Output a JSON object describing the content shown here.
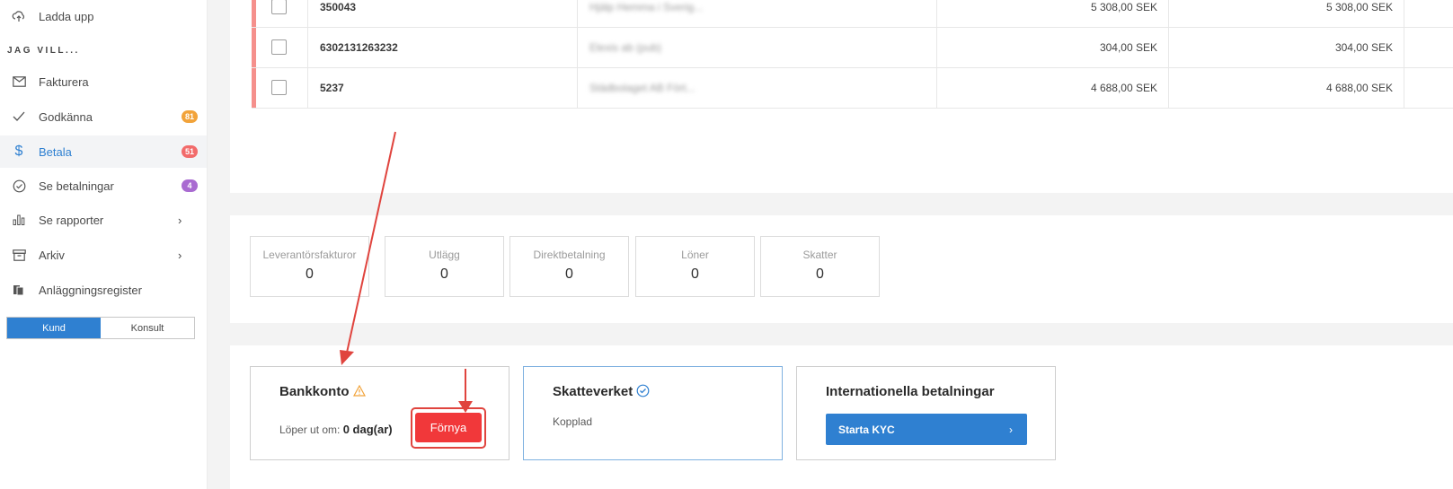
{
  "sidebar": {
    "upload_label": "Ladda upp",
    "section_title": "JAG VILL...",
    "items": [
      {
        "label": "Fakturera",
        "icon": "mail-icon"
      },
      {
        "label": "Godkänna",
        "icon": "check-icon",
        "badge": "81",
        "badge_color": "#f2a33a"
      },
      {
        "label": "Betala",
        "icon": "dollar-icon",
        "badge": "51",
        "badge_color": "#f26b6b"
      },
      {
        "label": "Se betalningar",
        "icon": "check-circle-icon",
        "badge": "4",
        "badge_color": "#a96bd1"
      },
      {
        "label": "Se rapporter",
        "icon": "bar-chart-icon"
      },
      {
        "label": "Arkiv",
        "icon": "archive-icon"
      },
      {
        "label": "Anläggningsregister",
        "icon": "files-icon"
      }
    ],
    "toggle": {
      "kund": "Kund",
      "konsult": "Konsult"
    }
  },
  "table": {
    "rows": [
      {
        "id": "350043",
        "name": "Hjälp Hemma i Sverig...",
        "amount1": "5 308,00 SEK",
        "amount2": "5 308,00 SEK"
      },
      {
        "id": "6302131263232",
        "name": "Elexis ab (pub)",
        "amount1": "304,00 SEK",
        "amount2": "304,00 SEK"
      },
      {
        "id": "5237",
        "name": "Städbolaget AB Fört...",
        "amount1": "4 688,00 SEK",
        "amount2": "4 688,00 SEK"
      }
    ]
  },
  "summary": [
    {
      "label": "Leverantörsfakturor",
      "value": "0"
    },
    {
      "label": "Utlägg",
      "value": "0"
    },
    {
      "label": "Direktbetalning",
      "value": "0"
    },
    {
      "label": "Löner",
      "value": "0"
    },
    {
      "label": "Skatter",
      "value": "0"
    }
  ],
  "cards": {
    "bank": {
      "title": "Bankkonto",
      "expires_prefix": "Löper ut om:",
      "expires_value": "0 dag(ar)",
      "renew_label": "Förnya"
    },
    "tax": {
      "title": "Skatteverket",
      "status": "Kopplad"
    },
    "intl": {
      "title": "Internationella betalningar",
      "kyc_label": "Starta KYC"
    }
  },
  "colors": {
    "accent": "#2f80d1",
    "danger": "#f1383a",
    "annotation_arrow": "#e0443e"
  }
}
